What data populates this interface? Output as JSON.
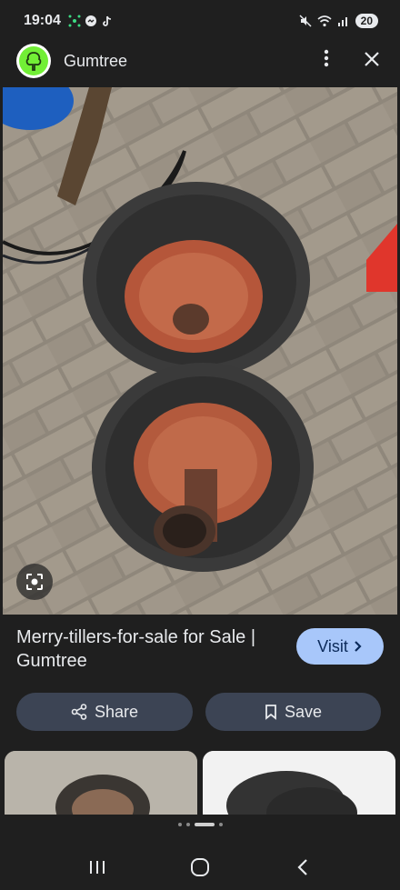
{
  "status": {
    "time": "19:04",
    "battery": "20"
  },
  "app_bar": {
    "title": "Gumtree"
  },
  "result": {
    "title": "Merry-tillers-for-sale for Sale | Gumtree",
    "visit_label": "Visit"
  },
  "actions": {
    "share_label": "Share",
    "save_label": "Save"
  },
  "icons": {
    "app": "gumtree-tree-icon",
    "menu": "more-vert-icon",
    "close": "close-icon",
    "lens": "lens-icon",
    "share": "share-icon",
    "save": "bookmark-icon",
    "visit": "chevron-right-icon"
  },
  "colors": {
    "background": "#1f1f1f",
    "visit_button": "#a8c7fa",
    "action_button": "#3c4454",
    "gumtree_green": "#72ef36"
  },
  "carousel": {
    "pages": 4,
    "active": 2
  }
}
